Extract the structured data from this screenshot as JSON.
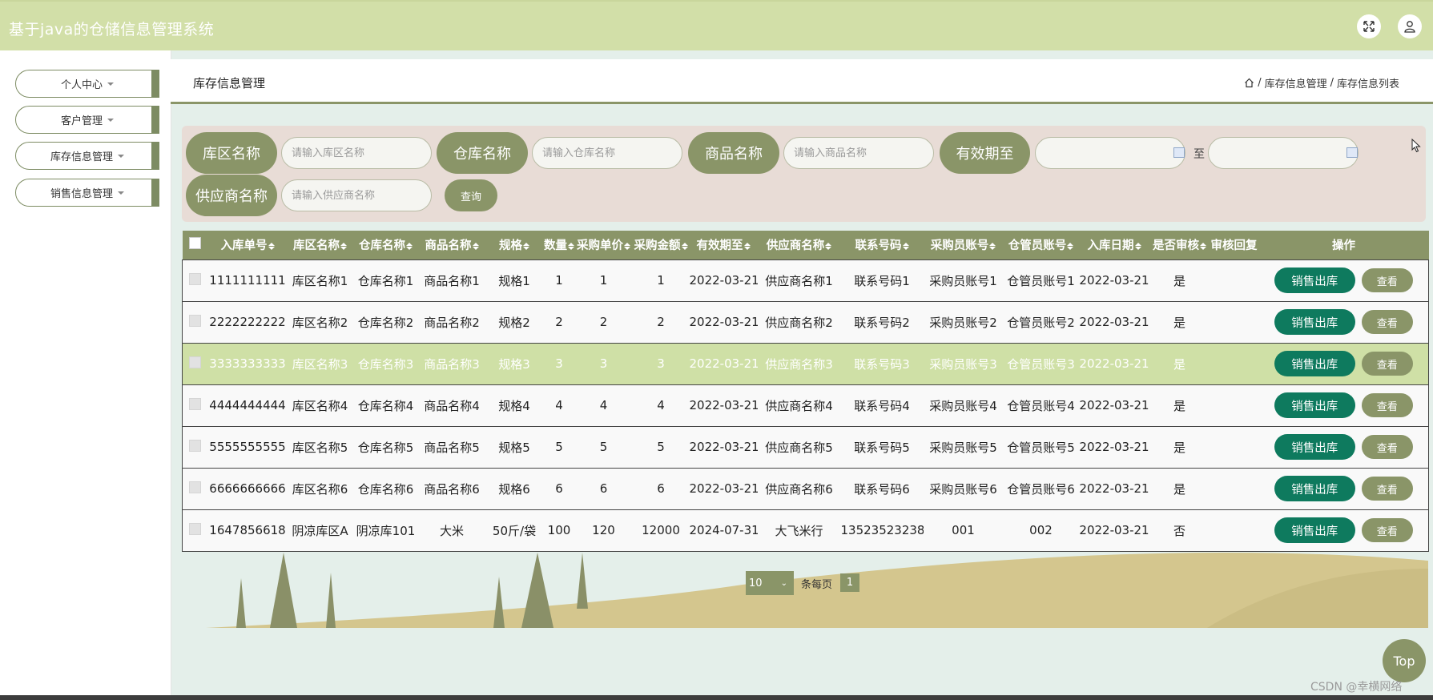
{
  "header": {
    "title": "基于java的仓储信息管理系统",
    "fullscreen_icon": "expand-icon",
    "user_icon": "user-icon"
  },
  "sidebar": {
    "items": [
      {
        "label": "个人中心"
      },
      {
        "label": "客户管理"
      },
      {
        "label": "库存信息管理"
      },
      {
        "label": "销售信息管理"
      }
    ]
  },
  "page": {
    "title": "库存信息管理",
    "breadcrumb": [
      "库存信息管理",
      "库存信息列表"
    ],
    "breadcrumb_sep": "/"
  },
  "search": {
    "area_label": "库区名称",
    "area_placeholder": "请输入库区名称",
    "warehouse_label": "仓库名称",
    "warehouse_placeholder": "请输入仓库名称",
    "product_label": "商品名称",
    "product_placeholder": "请输入商品名称",
    "expiry_label": "有效期至",
    "to_label": "至",
    "supplier_label": "供应商名称",
    "supplier_placeholder": "请输入供应商名称",
    "query_label": "查询"
  },
  "table": {
    "headers": [
      "入库单号",
      "库区名称",
      "仓库名称",
      "商品名称",
      "规格",
      "数量",
      "采购单价",
      "采购金额",
      "有效期至",
      "供应商名称",
      "联系号码",
      "采购员账号",
      "仓管员账号",
      "入库日期",
      "是否审核",
      "审核回复",
      "操作"
    ],
    "sell_label": "销售出库",
    "view_label": "查看",
    "rows": [
      [
        "1111111111",
        "库区名称1",
        "仓库名称1",
        "商品名称1",
        "规格1",
        "1",
        "1",
        "1",
        "2022-03-21",
        "供应商名称1",
        "联系号码1",
        "采购员账号1",
        "仓管员账号1",
        "2022-03-21",
        "是",
        ""
      ],
      [
        "2222222222",
        "库区名称2",
        "仓库名称2",
        "商品名称2",
        "规格2",
        "2",
        "2",
        "2",
        "2022-03-21",
        "供应商名称2",
        "联系号码2",
        "采购员账号2",
        "仓管员账号2",
        "2022-03-21",
        "是",
        ""
      ],
      [
        "3333333333",
        "库区名称3",
        "仓库名称3",
        "商品名称3",
        "规格3",
        "3",
        "3",
        "3",
        "2022-03-21",
        "供应商名称3",
        "联系号码3",
        "采购员账号3",
        "仓管员账号3",
        "2022-03-21",
        "是",
        ""
      ],
      [
        "4444444444",
        "库区名称4",
        "仓库名称4",
        "商品名称4",
        "规格4",
        "4",
        "4",
        "4",
        "2022-03-21",
        "供应商名称4",
        "联系号码4",
        "采购员账号4",
        "仓管员账号4",
        "2022-03-21",
        "是",
        ""
      ],
      [
        "5555555555",
        "库区名称5",
        "仓库名称5",
        "商品名称5",
        "规格5",
        "5",
        "5",
        "5",
        "2022-03-21",
        "供应商名称5",
        "联系号码5",
        "采购员账号5",
        "仓管员账号5",
        "2022-03-21",
        "是",
        ""
      ],
      [
        "6666666666",
        "库区名称6",
        "仓库名称6",
        "商品名称6",
        "规格6",
        "6",
        "6",
        "6",
        "2022-03-21",
        "供应商名称6",
        "联系号码6",
        "采购员账号6",
        "仓管员账号6",
        "2022-03-21",
        "是",
        ""
      ],
      [
        "1647856618",
        "阴凉库区A",
        "阴凉库101",
        "大米",
        "50斤/袋",
        "100",
        "120",
        "12000",
        "2024-07-31",
        "大飞米行",
        "13523523238",
        "001",
        "002",
        "2022-03-21",
        "否",
        ""
      ]
    ]
  },
  "pagination": {
    "page_size": "10",
    "per_page_label": "条每页",
    "current_page": "1"
  },
  "top_button": "Top",
  "watermark": "CSDN @幸横网络",
  "colors": {
    "header_bg": "#d2dfa8",
    "accent": "#8a9568",
    "sell_button": "#0e7a5e",
    "highlight_row": "#cfe0a6",
    "search_panel": "#e8dcd6"
  }
}
